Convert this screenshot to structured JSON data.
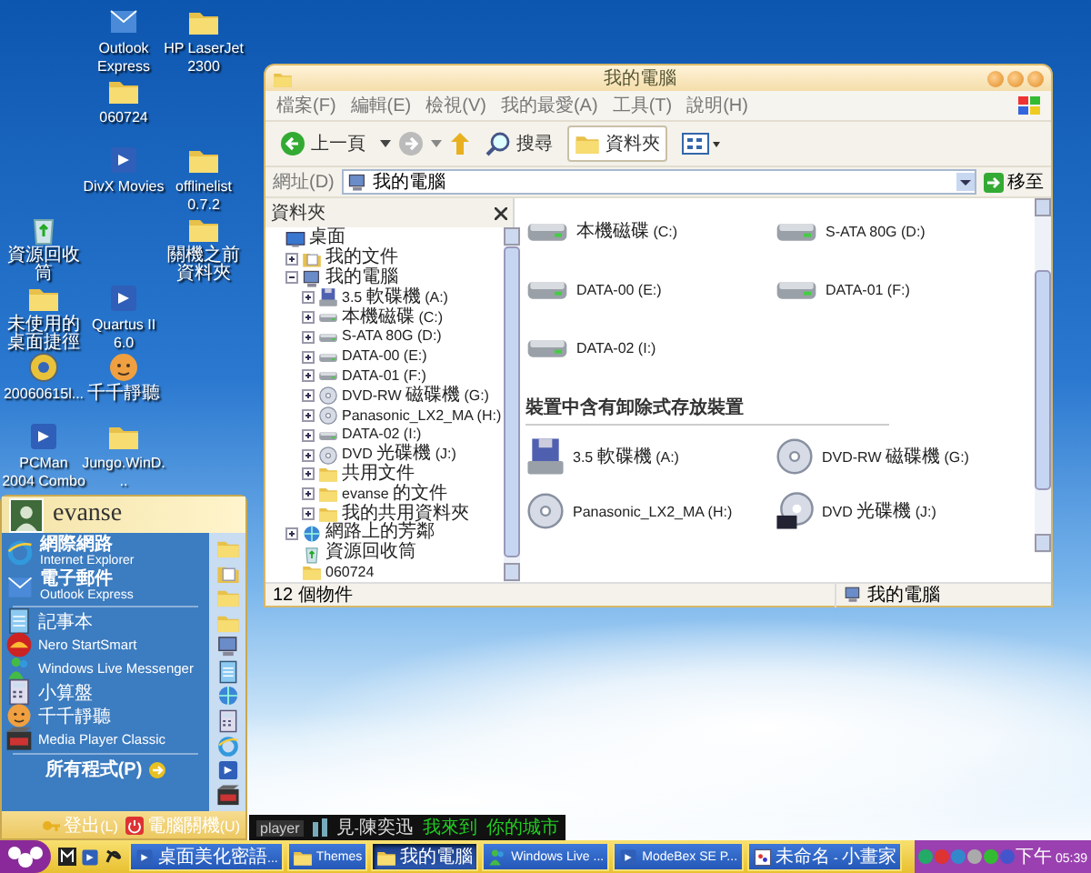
{
  "desktop": {
    "icons": [
      {
        "label": "Outlook Express",
        "kind": "mail"
      },
      {
        "label": "HP LaserJet 2300",
        "kind": "folder"
      },
      {
        "label": "060724",
        "kind": "folder"
      },
      {
        "label": "DivX Movies",
        "kind": "app"
      },
      {
        "label": "offlinelist 0.7.2",
        "kind": "folder"
      },
      {
        "label": "資源回收筒",
        "kind": "recycle"
      },
      {
        "label": "關機之前資料夾",
        "kind": "folder"
      },
      {
        "label": "未使用的桌面捷徑",
        "kind": "folder"
      },
      {
        "label": "Quartus II 6.0",
        "kind": "app"
      },
      {
        "label": "20060615l...",
        "kind": "disc"
      },
      {
        "label": "千千靜聽",
        "kind": "face"
      },
      {
        "label": "PCMan 2004 Combo",
        "kind": "app"
      },
      {
        "label": "Jungo.WinD...",
        "kind": "folder"
      }
    ]
  },
  "window": {
    "title": "我的電腦",
    "menu": [
      "檔案(F)",
      "編輯(E)",
      "檢視(V)",
      "我的最愛(A)",
      "工具(T)",
      "說明(H)"
    ],
    "toolbar": {
      "back": "上一頁",
      "search": "搜尋",
      "folders": {
        "label": "資料夾",
        "selected": true
      }
    },
    "address": {
      "label": "網址(D)",
      "value": "我的電腦",
      "go": "移至"
    },
    "folder_pane": {
      "title": "資料夾",
      "tree": [
        {
          "label": "桌面",
          "kind": "desktop",
          "children": [
            {
              "label": "我的文件",
              "kind": "docs",
              "expanded": false
            },
            {
              "label": "我的電腦",
              "kind": "pc",
              "expanded": true,
              "children": [
                {
                  "label": "3.5 軟碟機 (A:)",
                  "kind": "floppy",
                  "expanded": false
                },
                {
                  "label": "本機磁碟 (C:)",
                  "kind": "hdd",
                  "expanded": false
                },
                {
                  "label": "S-ATA 80G (D:)",
                  "kind": "hdd",
                  "expanded": false
                },
                {
                  "label": "DATA-00 (E:)",
                  "kind": "hdd",
                  "expanded": false
                },
                {
                  "label": "DATA-01 (F:)",
                  "kind": "hdd",
                  "expanded": false
                },
                {
                  "label": "DVD-RW 磁碟機 (G:)",
                  "kind": "cd",
                  "expanded": false
                },
                {
                  "label": "Panasonic_LX2_MA (H:)",
                  "kind": "cd",
                  "expanded": false
                },
                {
                  "label": "DATA-02 (I:)",
                  "kind": "hdd",
                  "expanded": false
                },
                {
                  "label": "DVD 光碟機 (J:)",
                  "kind": "cd",
                  "expanded": false
                },
                {
                  "label": "共用文件",
                  "kind": "folder",
                  "expanded": false
                },
                {
                  "label": "evanse 的文件",
                  "kind": "folder",
                  "expanded": false
                },
                {
                  "label": "我的共用資料夾",
                  "kind": "folder",
                  "expanded": false
                }
              ]
            },
            {
              "label": "網路上的芳鄰",
              "kind": "network",
              "expanded": false
            },
            {
              "label": "資源回收筒",
              "kind": "recycle"
            },
            {
              "label": "060724",
              "kind": "folder"
            }
          ]
        }
      ]
    },
    "content": {
      "groups": [
        {
          "items": [
            {
              "label": "本機磁碟 (C:)",
              "kind": "hdd"
            },
            {
              "label": "S-ATA 80G (D:)",
              "kind": "hdd"
            },
            {
              "label": "DATA-00 (E:)",
              "kind": "hdd"
            },
            {
              "label": "DATA-01 (F:)",
              "kind": "hdd"
            },
            {
              "label": "DATA-02 (I:)",
              "kind": "hdd"
            }
          ]
        },
        {
          "heading": "裝置中含有卸除式存放裝置",
          "items": [
            {
              "label": "3.5 軟碟機 (A:)",
              "kind": "floppy"
            },
            {
              "label": "DVD-RW 磁碟機 (G:)",
              "kind": "cd"
            },
            {
              "label": "Panasonic_LX2_MA (H:)",
              "kind": "cd"
            },
            {
              "label": "DVD 光碟機 (J:)",
              "kind": "dvd"
            }
          ]
        }
      ]
    },
    "status_bar": {
      "count": "12 個物件",
      "location": "我的電腦"
    }
  },
  "start_menu": {
    "user": "evanse",
    "pinned": [
      {
        "title": "網際網路",
        "subtitle": "Internet Explorer",
        "kind": "ie"
      },
      {
        "title": "電子郵件",
        "subtitle": "Outlook Express",
        "kind": "mail"
      }
    ],
    "recent": [
      {
        "label": "記事本",
        "kind": "notepad"
      },
      {
        "label": "Nero StartSmart",
        "kind": "nero"
      },
      {
        "label": "Windows Live Messenger",
        "kind": "messenger"
      },
      {
        "label": "小算盤",
        "kind": "calc"
      },
      {
        "label": "千千靜聽",
        "kind": "face"
      },
      {
        "label": "Media Player Classic",
        "kind": "media"
      }
    ],
    "all_programs": "所有程式(P)",
    "logoff": "登出(L)",
    "shutdown": "電腦關機(U)"
  },
  "player": {
    "name": "player",
    "song": "見-陳奕迅",
    "lyrics": [
      "我來到",
      "你的城市"
    ]
  },
  "taskbar": {
    "tasks": [
      {
        "label": "桌面美化密語...",
        "kind": "app",
        "selected": false
      },
      {
        "label": "Themes",
        "kind": "folder",
        "selected": false
      },
      {
        "label": "我的電腦",
        "kind": "folder",
        "selected": true
      },
      {
        "label": "Windows Live ...",
        "kind": "messenger",
        "selected": false
      },
      {
        "label": "ModeBex SE P...",
        "kind": "app",
        "selected": false
      },
      {
        "label": "未命名 - 小畫家",
        "kind": "paint",
        "selected": false
      }
    ],
    "clock": "下午 05:39"
  }
}
